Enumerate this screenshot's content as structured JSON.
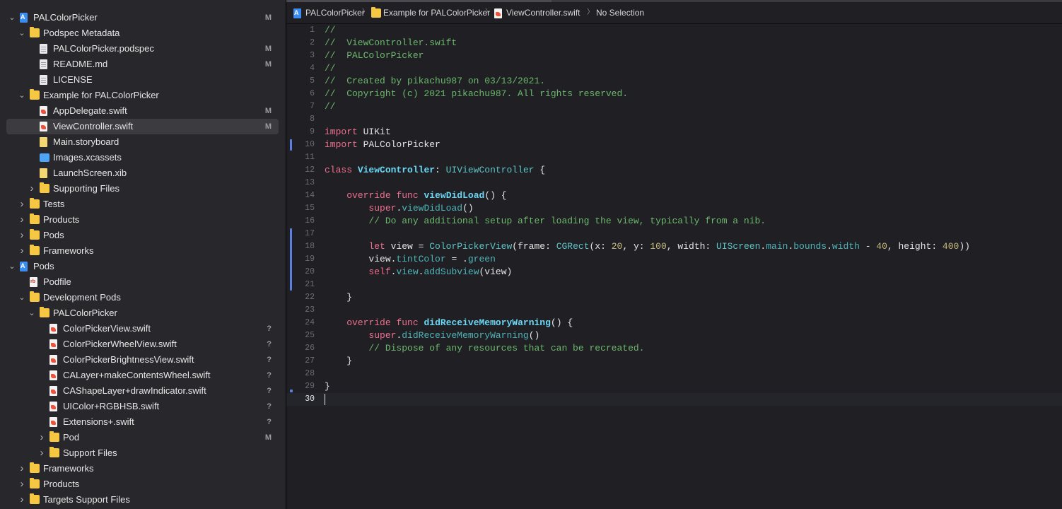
{
  "navigator": {
    "items": [
      {
        "depth": 0,
        "chevron": "down",
        "icon": "project-icon",
        "label": "PALColorPicker",
        "badge": "M"
      },
      {
        "depth": 1,
        "chevron": "down",
        "icon": "folder-icon",
        "label": "Podspec Metadata",
        "badge": ""
      },
      {
        "depth": 2,
        "chevron": "",
        "icon": "document-icon",
        "label": "PALColorPicker.podspec",
        "badge": "M"
      },
      {
        "depth": 2,
        "chevron": "",
        "icon": "document-icon",
        "label": "README.md",
        "badge": "M"
      },
      {
        "depth": 2,
        "chevron": "",
        "icon": "document-icon",
        "label": "LICENSE",
        "badge": ""
      },
      {
        "depth": 1,
        "chevron": "down",
        "icon": "folder-icon",
        "label": "Example for PALColorPicker",
        "badge": ""
      },
      {
        "depth": 2,
        "chevron": "",
        "icon": "swift-file-icon",
        "label": "AppDelegate.swift",
        "badge": "M"
      },
      {
        "depth": 2,
        "chevron": "",
        "icon": "swift-file-icon",
        "label": "ViewController.swift",
        "badge": "M",
        "selected": true
      },
      {
        "depth": 2,
        "chevron": "",
        "icon": "storyboard-icon",
        "label": "Main.storyboard",
        "badge": ""
      },
      {
        "depth": 2,
        "chevron": "",
        "icon": "asset-catalog-icon",
        "label": "Images.xcassets",
        "badge": ""
      },
      {
        "depth": 2,
        "chevron": "",
        "icon": "xib-file-icon",
        "label": "LaunchScreen.xib",
        "badge": ""
      },
      {
        "depth": 2,
        "chevron": "right",
        "icon": "folder-icon",
        "label": "Supporting Files",
        "badge": ""
      },
      {
        "depth": 1,
        "chevron": "right",
        "icon": "folder-icon",
        "label": "Tests",
        "badge": ""
      },
      {
        "depth": 1,
        "chevron": "right",
        "icon": "folder-icon",
        "label": "Products",
        "badge": ""
      },
      {
        "depth": 1,
        "chevron": "right",
        "icon": "folder-icon",
        "label": "Pods",
        "badge": ""
      },
      {
        "depth": 1,
        "chevron": "right",
        "icon": "folder-icon",
        "label": "Frameworks",
        "badge": ""
      },
      {
        "depth": 0,
        "chevron": "down",
        "icon": "project-icon",
        "label": "Pods",
        "badge": ""
      },
      {
        "depth": 1,
        "chevron": "",
        "icon": "ruby-file-icon",
        "label": "Podfile",
        "badge": ""
      },
      {
        "depth": 1,
        "chevron": "down",
        "icon": "folder-icon",
        "label": "Development Pods",
        "badge": ""
      },
      {
        "depth": 2,
        "chevron": "down",
        "icon": "folder-icon",
        "label": "PALColorPicker",
        "badge": ""
      },
      {
        "depth": 3,
        "chevron": "",
        "icon": "swift-file-icon",
        "label": "ColorPickerView.swift",
        "badge": "?"
      },
      {
        "depth": 3,
        "chevron": "",
        "icon": "swift-file-icon",
        "label": "ColorPickerWheelView.swift",
        "badge": "?"
      },
      {
        "depth": 3,
        "chevron": "",
        "icon": "swift-file-icon",
        "label": "ColorPickerBrightnessView.swift",
        "badge": "?"
      },
      {
        "depth": 3,
        "chevron": "",
        "icon": "swift-file-icon",
        "label": "CALayer+makeContentsWheel.swift",
        "badge": "?"
      },
      {
        "depth": 3,
        "chevron": "",
        "icon": "swift-file-icon",
        "label": "CAShapeLayer+drawIndicator.swift",
        "badge": "?"
      },
      {
        "depth": 3,
        "chevron": "",
        "icon": "swift-file-icon",
        "label": "UIColor+RGBHSB.swift",
        "badge": "?"
      },
      {
        "depth": 3,
        "chevron": "",
        "icon": "swift-file-icon",
        "label": "Extensions+.swift",
        "badge": "?"
      },
      {
        "depth": 3,
        "chevron": "right",
        "icon": "folder-icon",
        "label": "Pod",
        "badge": "M"
      },
      {
        "depth": 3,
        "chevron": "right",
        "icon": "folder-icon",
        "label": "Support Files",
        "badge": ""
      },
      {
        "depth": 1,
        "chevron": "right",
        "icon": "folder-icon",
        "label": "Frameworks",
        "badge": ""
      },
      {
        "depth": 1,
        "chevron": "right",
        "icon": "folder-icon",
        "label": "Products",
        "badge": ""
      },
      {
        "depth": 1,
        "chevron": "right",
        "icon": "folder-icon",
        "label": "Targets Support Files",
        "badge": ""
      }
    ]
  },
  "breadcrumb": [
    {
      "icon": "project-icon",
      "label": "PALColorPicker"
    },
    {
      "icon": "folder-icon",
      "label": "Example for PALColorPicker"
    },
    {
      "icon": "swift-file-icon",
      "label": "ViewController.swift"
    },
    {
      "icon": "",
      "label": "No Selection"
    }
  ],
  "editor": {
    "current_line": 30,
    "changed_lines": [
      10,
      17,
      18,
      19,
      20,
      21
    ],
    "lines": [
      {
        "n": "1",
        "tokens": [
          {
            "t": "//",
            "c": "comment"
          }
        ]
      },
      {
        "n": "2",
        "tokens": [
          {
            "t": "//  ViewController.swift",
            "c": "comment"
          }
        ]
      },
      {
        "n": "3",
        "tokens": [
          {
            "t": "//  PALColorPicker",
            "c": "comment"
          }
        ]
      },
      {
        "n": "4",
        "tokens": [
          {
            "t": "//",
            "c": "comment"
          }
        ]
      },
      {
        "n": "5",
        "tokens": [
          {
            "t": "//  Created by pikachu987 on 03/13/2021.",
            "c": "comment"
          }
        ]
      },
      {
        "n": "6",
        "tokens": [
          {
            "t": "//  Copyright (c) 2021 pikachu987. All rights reserved.",
            "c": "comment"
          }
        ]
      },
      {
        "n": "7",
        "tokens": [
          {
            "t": "//",
            "c": "comment"
          }
        ]
      },
      {
        "n": "8",
        "tokens": []
      },
      {
        "n": "9",
        "tokens": [
          {
            "t": "import",
            "c": "keyword"
          },
          {
            "t": " UIKit",
            "c": "plain"
          }
        ]
      },
      {
        "n": "10",
        "tokens": [
          {
            "t": "import",
            "c": "keyword"
          },
          {
            "t": " PALColorPicker",
            "c": "plain"
          }
        ]
      },
      {
        "n": "11",
        "tokens": []
      },
      {
        "n": "12",
        "tokens": [
          {
            "t": "class",
            "c": "keyword"
          },
          {
            "t": " ",
            "c": "plain"
          },
          {
            "t": "ViewController",
            "c": "decl"
          },
          {
            "t": ": ",
            "c": "plain"
          },
          {
            "t": "UIViewController",
            "c": "type"
          },
          {
            "t": " {",
            "c": "plain"
          }
        ]
      },
      {
        "n": "13",
        "tokens": []
      },
      {
        "n": "14",
        "tokens": [
          {
            "t": "    ",
            "c": "plain"
          },
          {
            "t": "override",
            "c": "keyword"
          },
          {
            "t": " ",
            "c": "plain"
          },
          {
            "t": "func",
            "c": "keyword"
          },
          {
            "t": " ",
            "c": "plain"
          },
          {
            "t": "viewDidLoad",
            "c": "decl"
          },
          {
            "t": "() {",
            "c": "plain"
          }
        ]
      },
      {
        "n": "15",
        "tokens": [
          {
            "t": "        ",
            "c": "plain"
          },
          {
            "t": "super",
            "c": "keyword"
          },
          {
            "t": ".",
            "c": "plain"
          },
          {
            "t": "viewDidLoad",
            "c": "member"
          },
          {
            "t": "()",
            "c": "plain"
          }
        ]
      },
      {
        "n": "16",
        "tokens": [
          {
            "t": "        // Do any additional setup after loading the view, typically from a nib.",
            "c": "comment"
          }
        ]
      },
      {
        "n": "17",
        "tokens": []
      },
      {
        "n": "18",
        "tokens": [
          {
            "t": "        ",
            "c": "plain"
          },
          {
            "t": "let",
            "c": "keyword"
          },
          {
            "t": " view = ",
            "c": "plain"
          },
          {
            "t": "ColorPickerView",
            "c": "type"
          },
          {
            "t": "(frame: ",
            "c": "plain"
          },
          {
            "t": "CGRect",
            "c": "type"
          },
          {
            "t": "(x: ",
            "c": "plain"
          },
          {
            "t": "20",
            "c": "number"
          },
          {
            "t": ", y: ",
            "c": "plain"
          },
          {
            "t": "100",
            "c": "number"
          },
          {
            "t": ", width: ",
            "c": "plain"
          },
          {
            "t": "UIScreen",
            "c": "type"
          },
          {
            "t": ".",
            "c": "plain"
          },
          {
            "t": "main",
            "c": "member"
          },
          {
            "t": ".",
            "c": "plain"
          },
          {
            "t": "bounds",
            "c": "member"
          },
          {
            "t": ".",
            "c": "plain"
          },
          {
            "t": "width",
            "c": "member"
          },
          {
            "t": " - ",
            "c": "plain"
          },
          {
            "t": "40",
            "c": "number"
          },
          {
            "t": ", height: ",
            "c": "plain"
          },
          {
            "t": "400",
            "c": "number"
          },
          {
            "t": "))",
            "c": "plain"
          }
        ]
      },
      {
        "n": "19",
        "tokens": [
          {
            "t": "        view.",
            "c": "plain"
          },
          {
            "t": "tintColor",
            "c": "member"
          },
          {
            "t": " = .",
            "c": "plain"
          },
          {
            "t": "green",
            "c": "member"
          }
        ]
      },
      {
        "n": "20",
        "tokens": [
          {
            "t": "        ",
            "c": "plain"
          },
          {
            "t": "self",
            "c": "keyword"
          },
          {
            "t": ".",
            "c": "plain"
          },
          {
            "t": "view",
            "c": "member"
          },
          {
            "t": ".",
            "c": "plain"
          },
          {
            "t": "addSubview",
            "c": "member"
          },
          {
            "t": "(view)",
            "c": "plain"
          }
        ]
      },
      {
        "n": "21",
        "tokens": []
      },
      {
        "n": "22",
        "tokens": [
          {
            "t": "    }",
            "c": "plain"
          }
        ]
      },
      {
        "n": "23",
        "tokens": []
      },
      {
        "n": "24",
        "tokens": [
          {
            "t": "    ",
            "c": "plain"
          },
          {
            "t": "override",
            "c": "keyword"
          },
          {
            "t": " ",
            "c": "plain"
          },
          {
            "t": "func",
            "c": "keyword"
          },
          {
            "t": " ",
            "c": "plain"
          },
          {
            "t": "didReceiveMemoryWarning",
            "c": "decl"
          },
          {
            "t": "() {",
            "c": "plain"
          }
        ]
      },
      {
        "n": "25",
        "tokens": [
          {
            "t": "        ",
            "c": "plain"
          },
          {
            "t": "super",
            "c": "keyword"
          },
          {
            "t": ".",
            "c": "plain"
          },
          {
            "t": "didReceiveMemoryWarning",
            "c": "member"
          },
          {
            "t": "()",
            "c": "plain"
          }
        ]
      },
      {
        "n": "26",
        "tokens": [
          {
            "t": "        // Dispose of any resources that can be recreated.",
            "c": "comment"
          }
        ]
      },
      {
        "n": "27",
        "tokens": [
          {
            "t": "    }",
            "c": "plain"
          }
        ]
      },
      {
        "n": "28",
        "tokens": []
      },
      {
        "n": "29",
        "tokens": [
          {
            "t": "}",
            "c": "plain"
          }
        ]
      },
      {
        "n": "30",
        "tokens": []
      }
    ]
  },
  "colors": {
    "sidebar_bg": "#28282c",
    "editor_bg": "#1f1f24",
    "comment": "#6cb86c",
    "keyword": "#f0708f",
    "change_bar": "#5a7fe0",
    "folder": "#f6c743"
  }
}
